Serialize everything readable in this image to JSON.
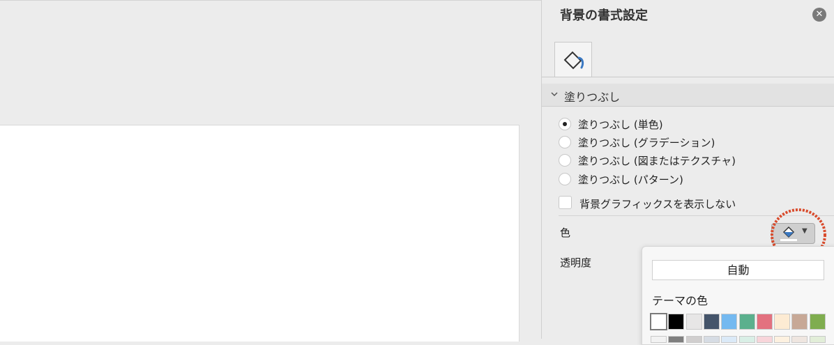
{
  "panel": {
    "title": "背景の書式設定",
    "close_icon": "close-icon",
    "tab_icon": "fill-bucket-icon",
    "section": {
      "label": "塗りつぶし",
      "expanded": true
    },
    "fill_options": [
      {
        "label": "塗りつぶし (単色)",
        "selected": true
      },
      {
        "label": "塗りつぶし (グラデーション)",
        "selected": false
      },
      {
        "label": "塗りつぶし (図またはテクスチャ)",
        "selected": false
      },
      {
        "label": "塗りつぶし (パターン)",
        "selected": false
      }
    ],
    "hide_background_graphics": {
      "label": "背景グラフィックスを表示しない",
      "checked": false
    },
    "color_label": "色",
    "transparency_label": "透明度"
  },
  "color_popup": {
    "auto_label": "自動",
    "theme_colors_label": "テーマの色",
    "theme_colors": [
      "#ffffff",
      "#000000",
      "#e7e6e6",
      "#44546a",
      "#74b9f0",
      "#5bb08d",
      "#e3717f",
      "#fdebd3",
      "#c7a896",
      "#7fad4f"
    ],
    "tint_row": [
      "#f2f2f2",
      "#7f7f7f",
      "#d0cece",
      "#d6dce4",
      "#dbeaf8",
      "#d9efe6",
      "#f8d5da",
      "#fdf1e0",
      "#efe6e0",
      "#e2eed8"
    ]
  }
}
